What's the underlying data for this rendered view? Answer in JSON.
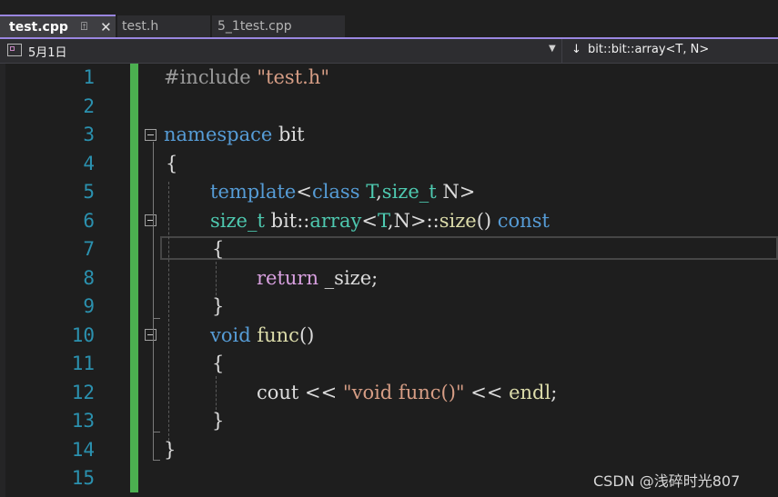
{
  "tabs": [
    {
      "label": "test.cpp",
      "active": true
    },
    {
      "label": "test.h",
      "active": false
    },
    {
      "label": "5_1test.cpp",
      "active": false
    }
  ],
  "tab_icons": {
    "pin": "pin-icon",
    "close": "close-icon"
  },
  "navbar": {
    "scope_label": "5月1日",
    "member_label": "bit::bit::array<T, N>",
    "member_prefix_icon": "↓"
  },
  "line_numbers": [
    "1",
    "2",
    "3",
    "4",
    "5",
    "6",
    "7",
    "8",
    "9",
    "10",
    "11",
    "12",
    "13",
    "14",
    "15"
  ],
  "code": {
    "l1": {
      "pp": "#include ",
      "str": "\"test.h\""
    },
    "l3": {
      "kw": "namespace",
      "rest": " bit"
    },
    "l4": "{",
    "l5": {
      "kw": "template",
      "a": "<",
      "kw2": "class",
      "sp": " ",
      "t": "T",
      "c": ",",
      "ty": "size_t",
      "sp2": " ",
      "n": "N",
      "b": ">"
    },
    "l6": {
      "ty": "size_t",
      "sp": " bit::",
      "ty2": "array",
      "a": "<",
      "t": "T",
      "c": ",",
      "n": "N",
      "b": ">::",
      "fn": "size",
      "p": "() ",
      "kw": "const"
    },
    "l7": "{",
    "l8": {
      "kw": "return",
      "rest": " _size;"
    },
    "l9": "}",
    "l10": {
      "kw": "void",
      "sp": " ",
      "fn": "func",
      "p": "()"
    },
    "l11": "{",
    "l12": {
      "a": "cout",
      "b": " << ",
      "str": "\"void func()\"",
      "c": " << ",
      "fn": "endl",
      "d": ";"
    },
    "l13": "}",
    "l14": "}"
  },
  "watermark": "CSDN @浅碎时光807",
  "colors": {
    "tab_accent": "#9a86e0",
    "change_bar": "#4caf50",
    "line_number": "#2b91af",
    "keyword": "#569cd6",
    "control_keyword": "#d8a0df",
    "type": "#4ec9b0",
    "function": "#dcdcaa",
    "string": "#d69d85"
  }
}
